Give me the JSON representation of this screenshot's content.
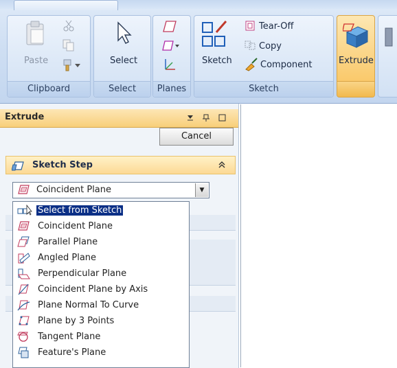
{
  "ribbon": {
    "groups": [
      {
        "label": "Clipboard",
        "buttons": [
          "Paste"
        ]
      },
      {
        "label": "Select",
        "buttons": [
          "Select"
        ]
      },
      {
        "label": "Planes",
        "buttons": []
      },
      {
        "label": "Sketch",
        "buttons": [
          "Sketch",
          "Tear-Off",
          "Copy",
          "Component"
        ]
      },
      {
        "label": "",
        "buttons": [
          "Extrude"
        ]
      }
    ]
  },
  "panel": {
    "title": "Extrude",
    "controls": "▼ 𝟰 □",
    "cancel_label": "Cancel",
    "section_title": "Sketch Step",
    "combo_value": "Coincident Plane",
    "dropdown": [
      {
        "label": "Select from Sketch",
        "icon": "select-from-sketch-icon",
        "selected": true
      },
      {
        "label": "Coincident Plane",
        "icon": "coincident-plane-icon"
      },
      {
        "label": "Parallel Plane",
        "icon": "parallel-plane-icon"
      },
      {
        "label": "Angled Plane",
        "icon": "angled-plane-icon"
      },
      {
        "label": "Perpendicular Plane",
        "icon": "perpendicular-plane-icon"
      },
      {
        "label": "Coincident Plane by Axis",
        "icon": "coincident-plane-by-axis-icon"
      },
      {
        "label": "Plane Normal To Curve",
        "icon": "plane-normal-to-curve-icon"
      },
      {
        "label": "Plane by 3 Points",
        "icon": "plane-by-3-points-icon"
      },
      {
        "label": "Tangent Plane",
        "icon": "tangent-plane-icon"
      },
      {
        "label": "Feature's Plane",
        "icon": "features-plane-icon"
      }
    ]
  },
  "colors": {
    "ribbon_bg": "#d2e1f4",
    "panel_header": "#f8cf7a",
    "selection": "#0b2f86",
    "extrude_active": "#f9c25a"
  }
}
